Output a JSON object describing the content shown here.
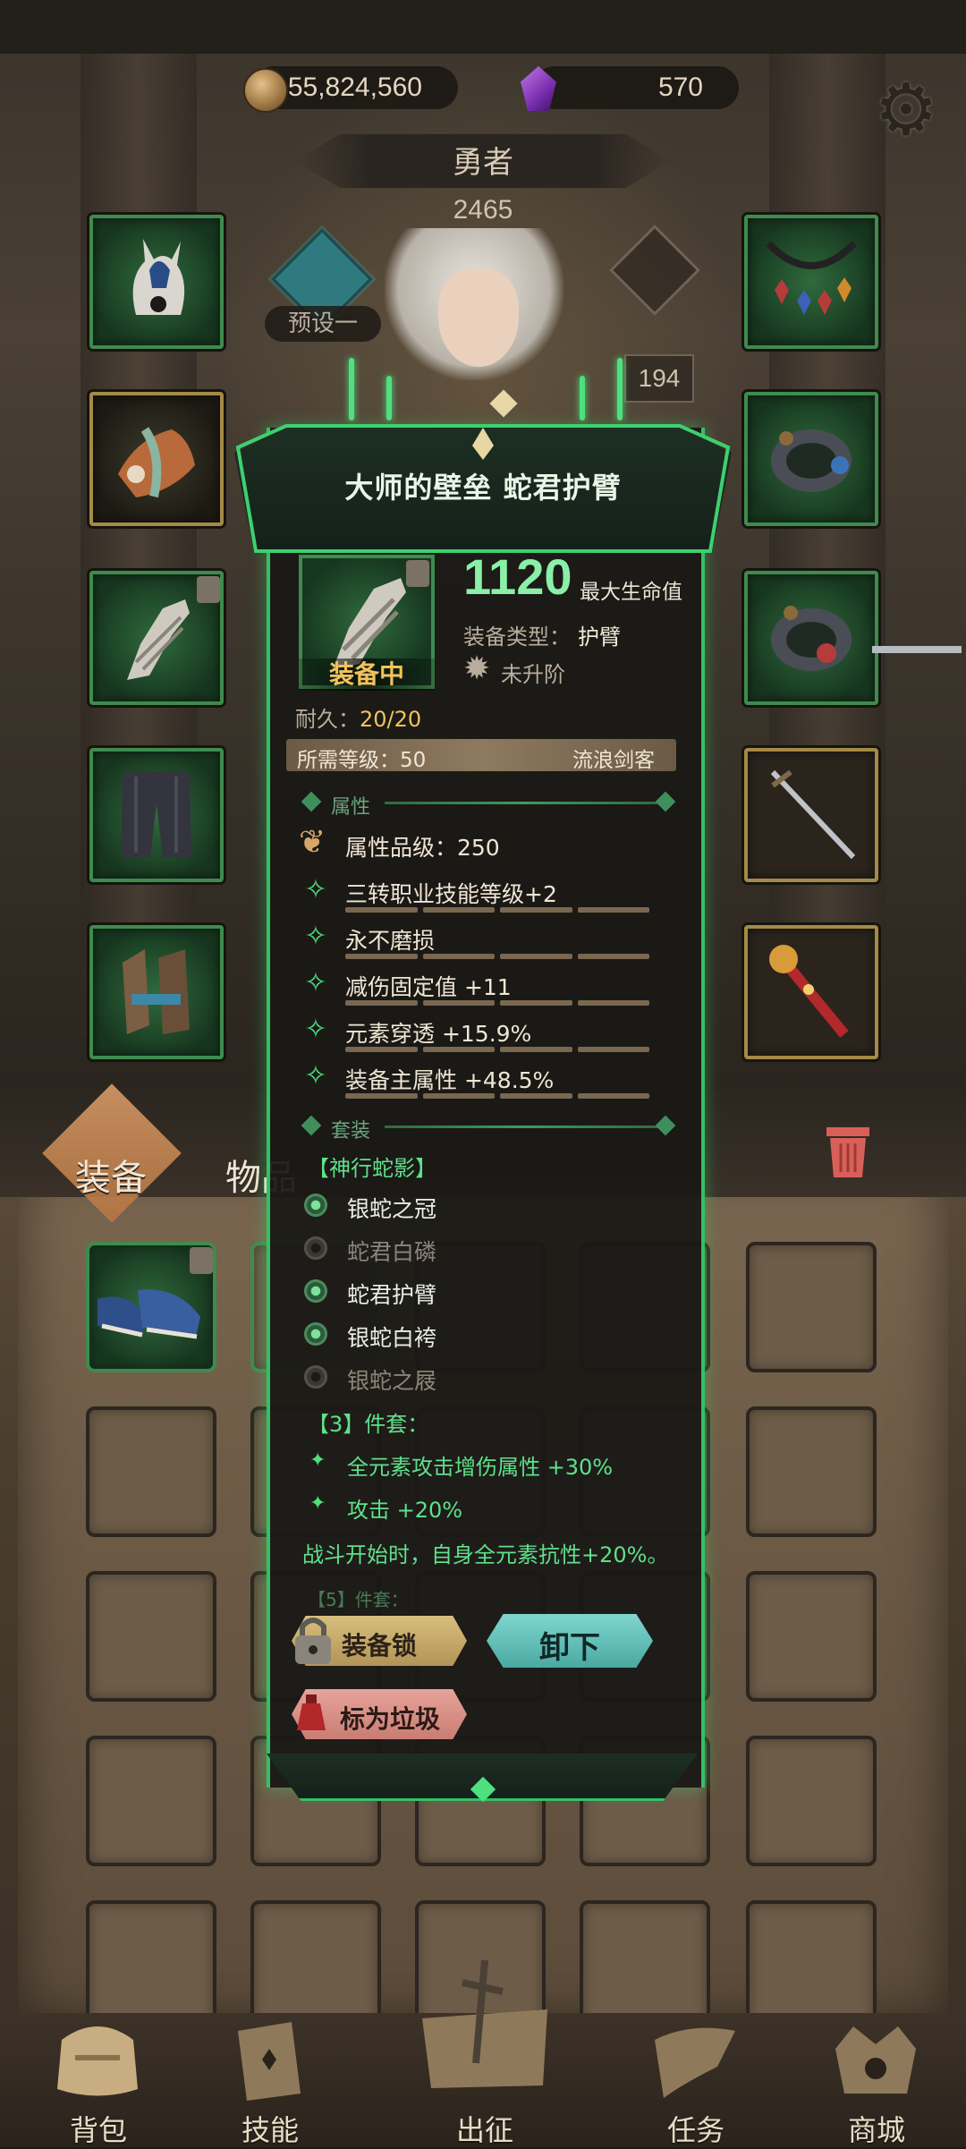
{
  "currency": {
    "gold": "55,824,560",
    "gems": "570"
  },
  "hero": {
    "name": "勇者",
    "level": "2465",
    "preset_label": "预设一",
    "stat_value": "194"
  },
  "tabs": {
    "equipment": "装备",
    "items": "物品"
  },
  "popup": {
    "title": "大师的壁垒 蛇君护臂",
    "stat_value": "1120",
    "stat_name": "最大生命值",
    "type_label": "装备类型：",
    "type_value": "护臂",
    "upgrade_label": "未升阶",
    "equipped_label": "装备中",
    "durability_label": "耐久：",
    "durability_value": "20/20",
    "required_level_label": "所需等级：50",
    "required_class": "流浪剑客",
    "section_attributes": "属性",
    "quality_label": "属性品级：250",
    "affixes": [
      {
        "text": "三转职业技能等级+2",
        "fill": 1.0
      },
      {
        "text": "永不磨损",
        "fill": 1.0
      },
      {
        "text": "减伤固定值 +11",
        "fill": 1.0
      },
      {
        "text": "元素穿透 +15.9%",
        "fill": 1.0
      },
      {
        "text": "装备主属性 +48.5%",
        "fill": 1.0
      }
    ],
    "section_set": "套装",
    "set_name": "【神行蛇影】",
    "set_items": [
      {
        "name": "银蛇之冠",
        "owned": true
      },
      {
        "name": "蛇君白磷",
        "owned": false
      },
      {
        "name": "蛇君护臂",
        "owned": true
      },
      {
        "name": "银蛇白袴",
        "owned": true
      },
      {
        "name": "银蛇之屐",
        "owned": false
      }
    ],
    "set_bonus_header": "【3】件套：",
    "set_bonuses": [
      "全元素攻击增伤属性 +30%",
      "攻击 +20%"
    ],
    "set_bonus_note": "战斗开始时，自身全元素抗性+20%。",
    "set_next_header_cut": "【5】件套：",
    "buttons": {
      "lock": "装备锁",
      "unequip": "卸下",
      "mark_junk": "标为垃圾"
    }
  },
  "bottom_nav": [
    {
      "label": "背包",
      "icon": "backpack-icon"
    },
    {
      "label": "技能",
      "icon": "skill-book-icon"
    },
    {
      "label": "出征",
      "icon": "map-sword-icon"
    },
    {
      "label": "任务",
      "icon": "scroll-icon"
    },
    {
      "label": "商城",
      "icon": "shop-icon"
    }
  ],
  "colors": {
    "popup_border": "#33c065",
    "rarity_green": "#3e8b4e",
    "rarity_gold": "#a58a45",
    "equipped_yellow": "#f2c25b",
    "bonus_green": "#5fe08b"
  }
}
